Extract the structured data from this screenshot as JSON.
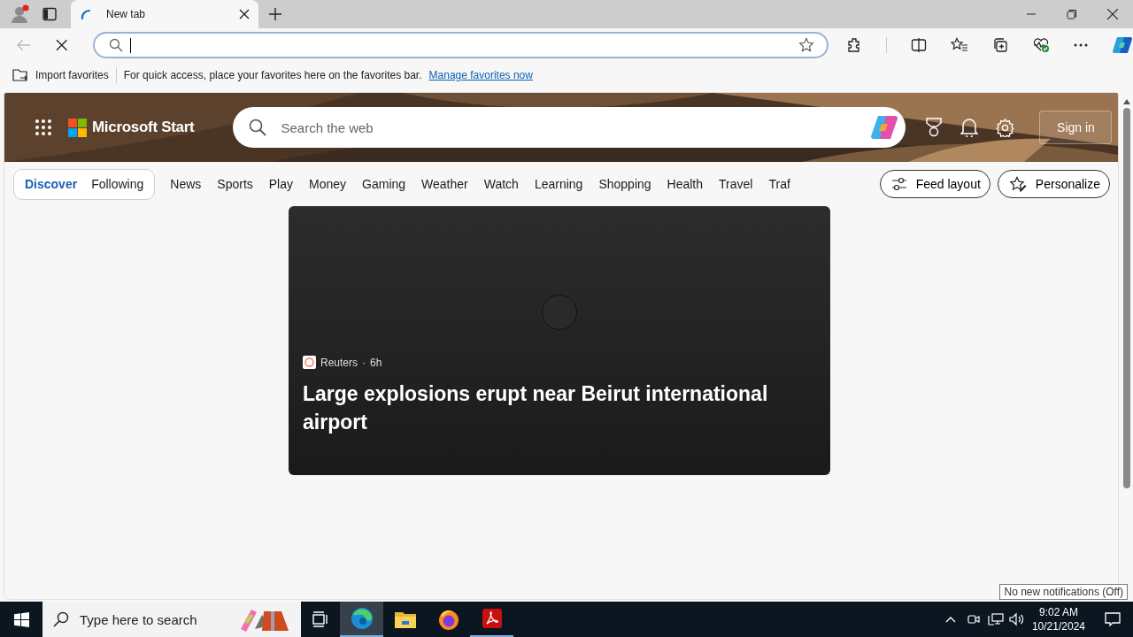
{
  "browser": {
    "tabs": [
      {
        "title": "New tab",
        "selected": true,
        "loading": true
      }
    ],
    "favorites_bar": {
      "import_label": "Import favorites",
      "message": "For quick access, place your favorites here on the favorites bar.",
      "link": "Manage favorites now"
    }
  },
  "page": {
    "brand": "Microsoft Start",
    "search": {
      "placeholder": "Search the web"
    },
    "sign_in": "Sign in",
    "feed_tabs": [
      {
        "label": "Discover",
        "selected": true
      },
      {
        "label": "Following",
        "selected": false
      }
    ],
    "categories": [
      "News",
      "Sports",
      "Play",
      "Money",
      "Gaming",
      "Weather",
      "Watch",
      "Learning",
      "Shopping",
      "Health",
      "Travel",
      "Traf"
    ],
    "feed_layout": "Feed layout",
    "personalize": "Personalize",
    "story": {
      "source": "Reuters",
      "separator": "·",
      "age": "6h",
      "headline": "Large explosions erupt near Beirut international airport"
    }
  },
  "taskbar": {
    "search": {
      "placeholder": "Type here to search"
    },
    "apps": [
      {
        "kind": "edge",
        "selected": true
      },
      {
        "kind": "explorer",
        "selected": false
      },
      {
        "kind": "firefox",
        "selected": false
      },
      {
        "kind": "acrobat",
        "selected": true
      }
    ],
    "time": "9:02 AM",
    "date": "10/21/2024",
    "tooltip": "No new notifications (Off)"
  }
}
